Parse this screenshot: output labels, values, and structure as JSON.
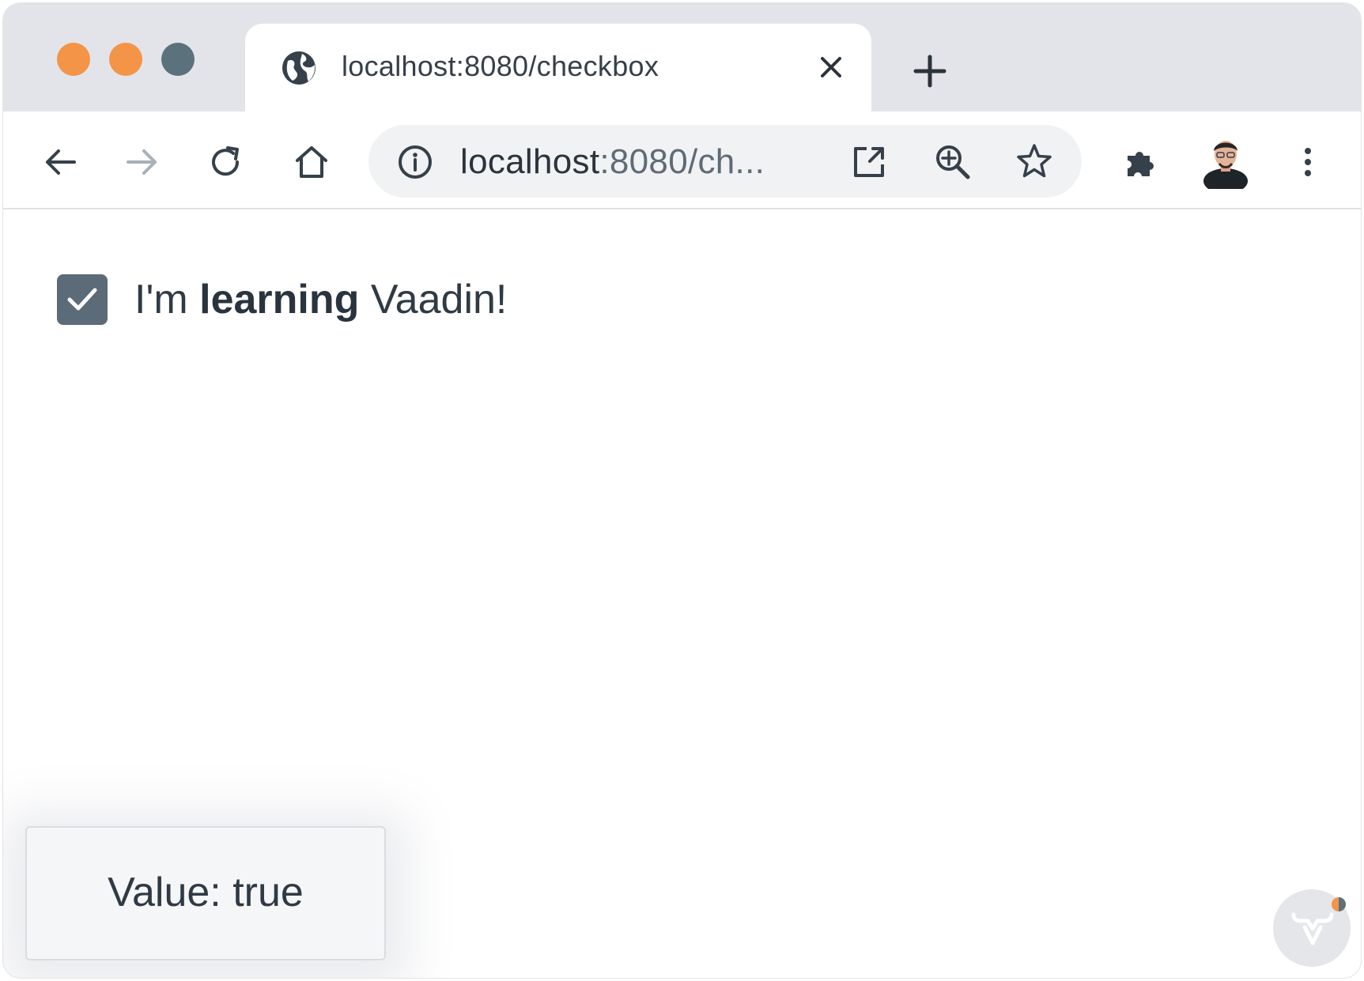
{
  "browser": {
    "tab": {
      "title": "localhost:8080/checkbox"
    },
    "omnibox": {
      "url_host": "localhost",
      "url_rest": ":8080/ch..."
    },
    "colors": {
      "accent_orange": "#f39447",
      "slate": "#5b717c"
    }
  },
  "page": {
    "checkbox": {
      "checked": true,
      "label_prefix": "I'm ",
      "label_bold": "learning",
      "label_suffix": " Vaadin!"
    },
    "notification": {
      "text": "Value: true"
    }
  }
}
